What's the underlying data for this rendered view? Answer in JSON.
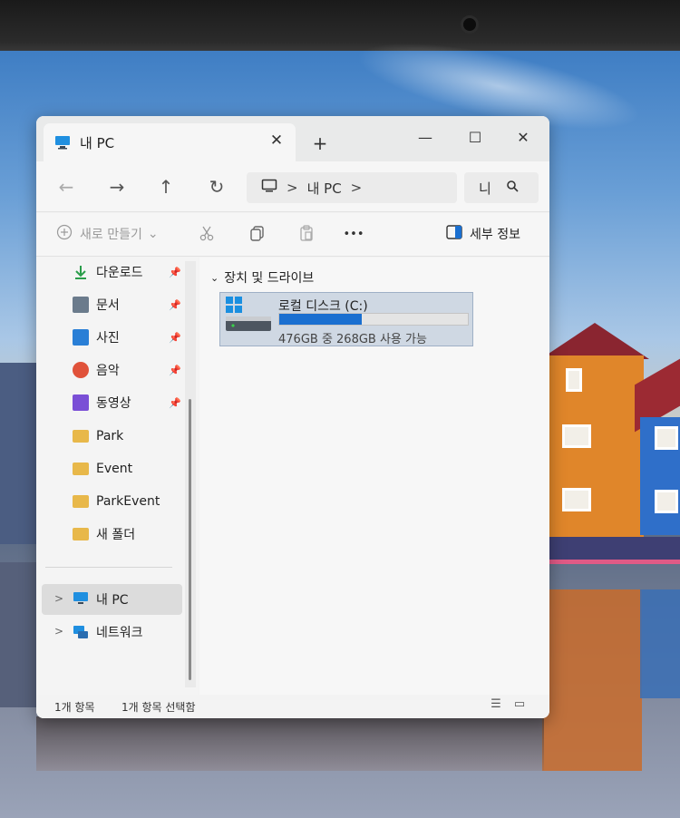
{
  "window": {
    "tab_title": "내 PC",
    "tab_close": "✕",
    "new_tab": "+",
    "minimize": "—",
    "maximize": "☐",
    "close": "✕"
  },
  "nav": {
    "back": "←",
    "forward": "→",
    "up": "↑",
    "refresh": "↻",
    "address": {
      "segments": [
        "내 PC"
      ],
      "chevron": ">"
    },
    "search_placeholder": "니"
  },
  "toolbar": {
    "new_label": "새로 만들기",
    "new_caret": "⌄",
    "more": "•••",
    "details_label": "세부 정보"
  },
  "sidebar": {
    "pinned": [
      {
        "label": "다운로드",
        "icon": "download-icon",
        "color": "#2a9d4a"
      },
      {
        "label": "문서",
        "icon": "document-icon",
        "color": "#6b7b8c"
      },
      {
        "label": "사진",
        "icon": "pictures-icon",
        "color": "#2a7fd6"
      },
      {
        "label": "음악",
        "icon": "music-icon",
        "color": "#e0523a"
      },
      {
        "label": "동영상",
        "icon": "videos-icon",
        "color": "#7a4fd6"
      }
    ],
    "folders": [
      {
        "label": "Park",
        "icon": "folder-icon"
      },
      {
        "label": "Event",
        "icon": "folder-icon"
      },
      {
        "label": "ParkEvent",
        "icon": "folder-icon"
      },
      {
        "label": "새 폴더",
        "icon": "folder-icon"
      }
    ],
    "this_pc": "내 PC",
    "network": "네트워크",
    "chevron": ">"
  },
  "content": {
    "group_header": "장치 및 드라이브",
    "group_caret": "⌄",
    "drive": {
      "name": "로컬 디스크 (C:)",
      "space": "476GB 중 268GB 사용 가능",
      "used_fraction": 0.437,
      "fill_color": "#1a6fd0"
    }
  },
  "status": {
    "item_count": "1개 항목",
    "selected": "1개 항목 선택함"
  },
  "colors": {
    "accent": "#1a6fd0",
    "folder": "#e8b84a"
  }
}
